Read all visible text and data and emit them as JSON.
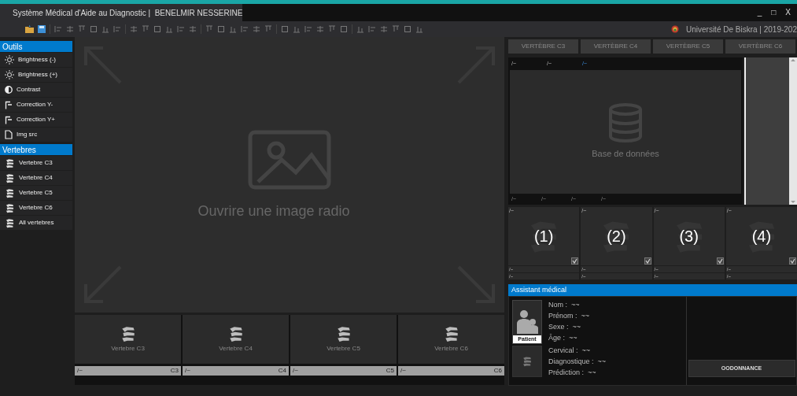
{
  "window": {
    "title": "Système Médical d'Aide au Diagnostic |  BENELMIR NESSERINE",
    "controls": [
      "_",
      "□",
      "X"
    ]
  },
  "toolbar": {
    "university": "Université De Biskra | 2019-202"
  },
  "sidebar": {
    "sections": [
      {
        "title": "Outils",
        "items": [
          {
            "label": "Brightness (-)",
            "kind": "sun"
          },
          {
            "label": "Brightness (+)",
            "kind": "sun"
          },
          {
            "label": "Contrast",
            "kind": "contrast"
          },
          {
            "label": "Correction Y-",
            "kind": "gamma"
          },
          {
            "label": "Correction Y+",
            "kind": "gamma"
          },
          {
            "label": "Img src",
            "kind": "file"
          }
        ]
      },
      {
        "title": "Vertebres",
        "items": [
          {
            "label": "Vertebre C3",
            "kind": "spine"
          },
          {
            "label": "Vertebre C4",
            "kind": "spine"
          },
          {
            "label": "Vertebre C5",
            "kind": "spine"
          },
          {
            "label": "Vertebre C6",
            "kind": "spine"
          },
          {
            "label": "All vertebres",
            "kind": "spine"
          }
        ]
      }
    ]
  },
  "viewer": {
    "placeholder": "Ouvrire une image radio",
    "thumbnails": [
      {
        "caption": "Vertebre C3",
        "path": "/~",
        "code": "C3"
      },
      {
        "caption": "Vertebre C4",
        "path": "/~",
        "code": "C4"
      },
      {
        "caption": "Vertebre C5",
        "path": "/~",
        "code": "C5"
      },
      {
        "caption": "Vertebre C6",
        "path": "/~",
        "code": "C6"
      }
    ]
  },
  "tabs": [
    {
      "label": "VERTÈBRE C3",
      "disabled": true
    },
    {
      "label": "VERTÈBRE C4",
      "disabled": true
    },
    {
      "label": "VERTÈBRE C5",
      "disabled": true
    },
    {
      "label": "VERTÈBRE C6",
      "disabled": true
    }
  ],
  "database": {
    "header": [
      {
        "text": "/~",
        "highlighted": false
      },
      {
        "text": "/~",
        "highlighted": false
      },
      {
        "text": "/~",
        "highlighted": true
      }
    ],
    "label": "Base de données",
    "footer": [
      "/~",
      "/~",
      "/~",
      "/~"
    ]
  },
  "cards": [
    {
      "number": "(1)",
      "top": "/~",
      "line_1": "/~",
      "line_2": "/~",
      "checked": true
    },
    {
      "number": "(2)",
      "top": "/~",
      "line_1": "/~",
      "line_2": "/~",
      "checked": true
    },
    {
      "number": "(3)",
      "top": "/~",
      "line_1": "/~",
      "line_2": "/~",
      "checked": true
    },
    {
      "number": "(4)",
      "top": "/~",
      "line_1": "/~",
      "line_2": "/~",
      "checked": true
    }
  ],
  "assistant": {
    "title": "Assistant médical",
    "patient_label": "Patient",
    "patient_fields": [
      "Nom :  ~~",
      "Prénom :  ~~",
      "Sexe :  ~~",
      "Âge :  ~~"
    ],
    "diagnosis_fields": [
      "Cervical :  ~~",
      "Diagnostique :  ~~",
      "Prédiction :  ~~"
    ],
    "button": "OODONNANCE"
  }
}
